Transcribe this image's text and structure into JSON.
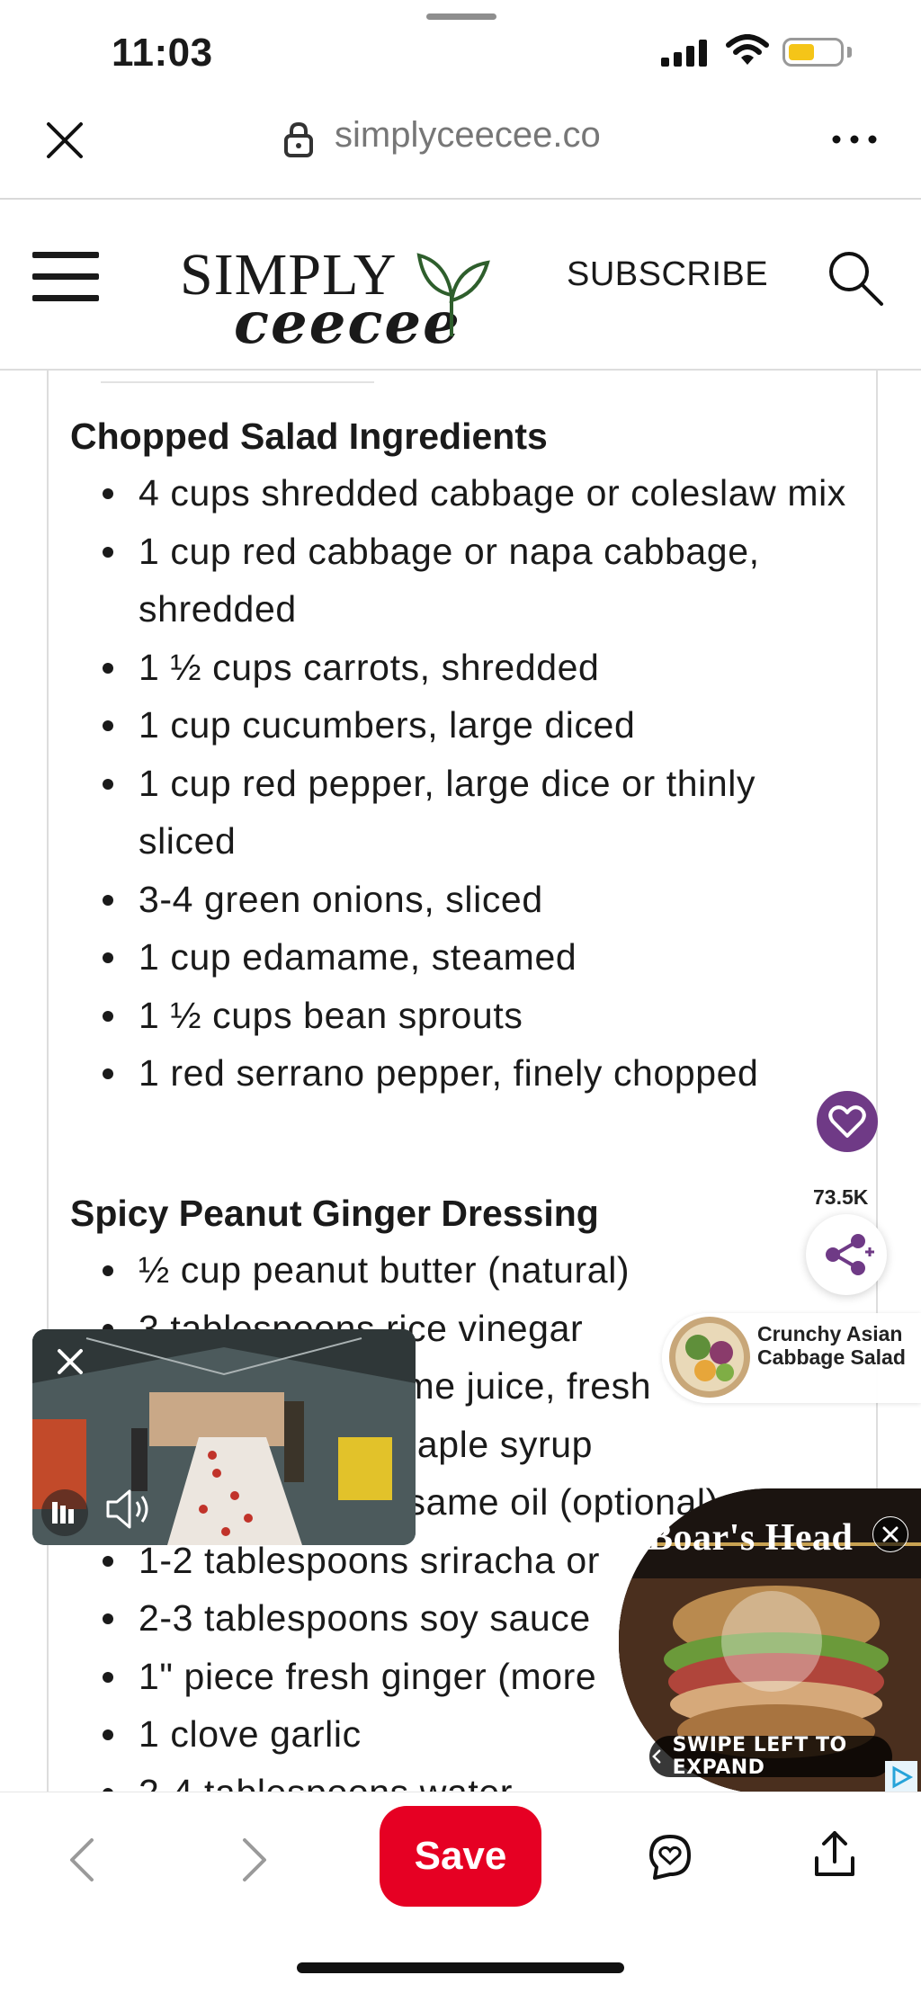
{
  "status_bar": {
    "time": "11:03"
  },
  "browser": {
    "url": "simplyceecee.co"
  },
  "site_header": {
    "logo_line1": "SIMPLY",
    "logo_line2": "ceecee",
    "subscribe_label": "SUBSCRIBE"
  },
  "article": {
    "section1": {
      "title": "Chopped Salad Ingredients",
      "items": [
        "4 cups shredded cabbage or coleslaw mix",
        "1 cup red cabbage or napa cabbage, shredded",
        "1 ½ cups carrots, shredded",
        "1 cup cucumbers, large diced",
        "1 cup red pepper, large dice or thinly sliced",
        "3-4 green onions, sliced",
        "1 cup edamame, steamed",
        "1 ½ cups bean sprouts",
        "1 red serrano pepper, finely chopped"
      ]
    },
    "section2": {
      "title": "Spicy Peanut Ginger Dressing",
      "items": [
        "½ cup peanut butter (natural)",
        "3 tablespoons rice vinegar",
        "2 tablespoons lime juice, fresh",
        "2 tablespoons maple syrup",
        "1 tablespoon sesame oil (optional)",
        "1-2 tablespoons sriracha or",
        "2-3 tablespoons soy sauce",
        "1\" piece fresh ginger (more",
        "1 clove garlic",
        "2-4 tablespoons water"
      ]
    }
  },
  "floating": {
    "save_count": "73.5K",
    "suggested_pin": "Crunchy Asian Cabbage Salad"
  },
  "ad": {
    "brand": "Boar's Head",
    "cta": "SWIPE LEFT TO EXPAND"
  },
  "bottom_bar": {
    "save_label": "Save"
  },
  "colors": {
    "save_red": "#e60023",
    "heart_purple": "#6f3a86",
    "logo_green": "#2e5e2c"
  }
}
